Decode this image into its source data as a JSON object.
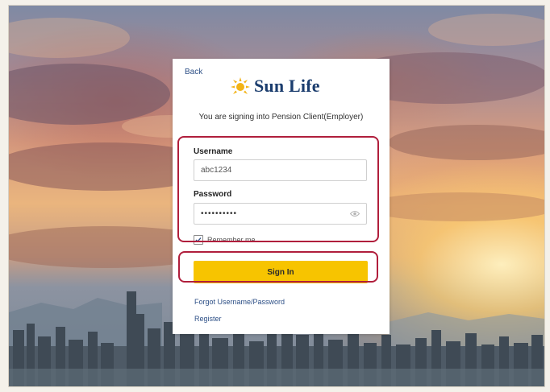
{
  "back_label": "Back",
  "brand": {
    "name": "Sun Life",
    "logo_icon": "sun-icon",
    "name_color": "#1b3d6e",
    "accent": "#f2b316"
  },
  "intro_text": "You are signing into Pension Client(Employer)",
  "username": {
    "label": "Username",
    "value": "abc1234"
  },
  "password": {
    "label": "Password",
    "value": "••••••••••",
    "toggle_icon": "eye-icon"
  },
  "remember_me": {
    "label": "Remember me",
    "checked": true
  },
  "signin_label": "Sign In",
  "signin_color": "#f7c400",
  "links": {
    "forgot": "Forgot Username/Password",
    "register": "Register"
  },
  "highlight_color": "#b01e3c"
}
